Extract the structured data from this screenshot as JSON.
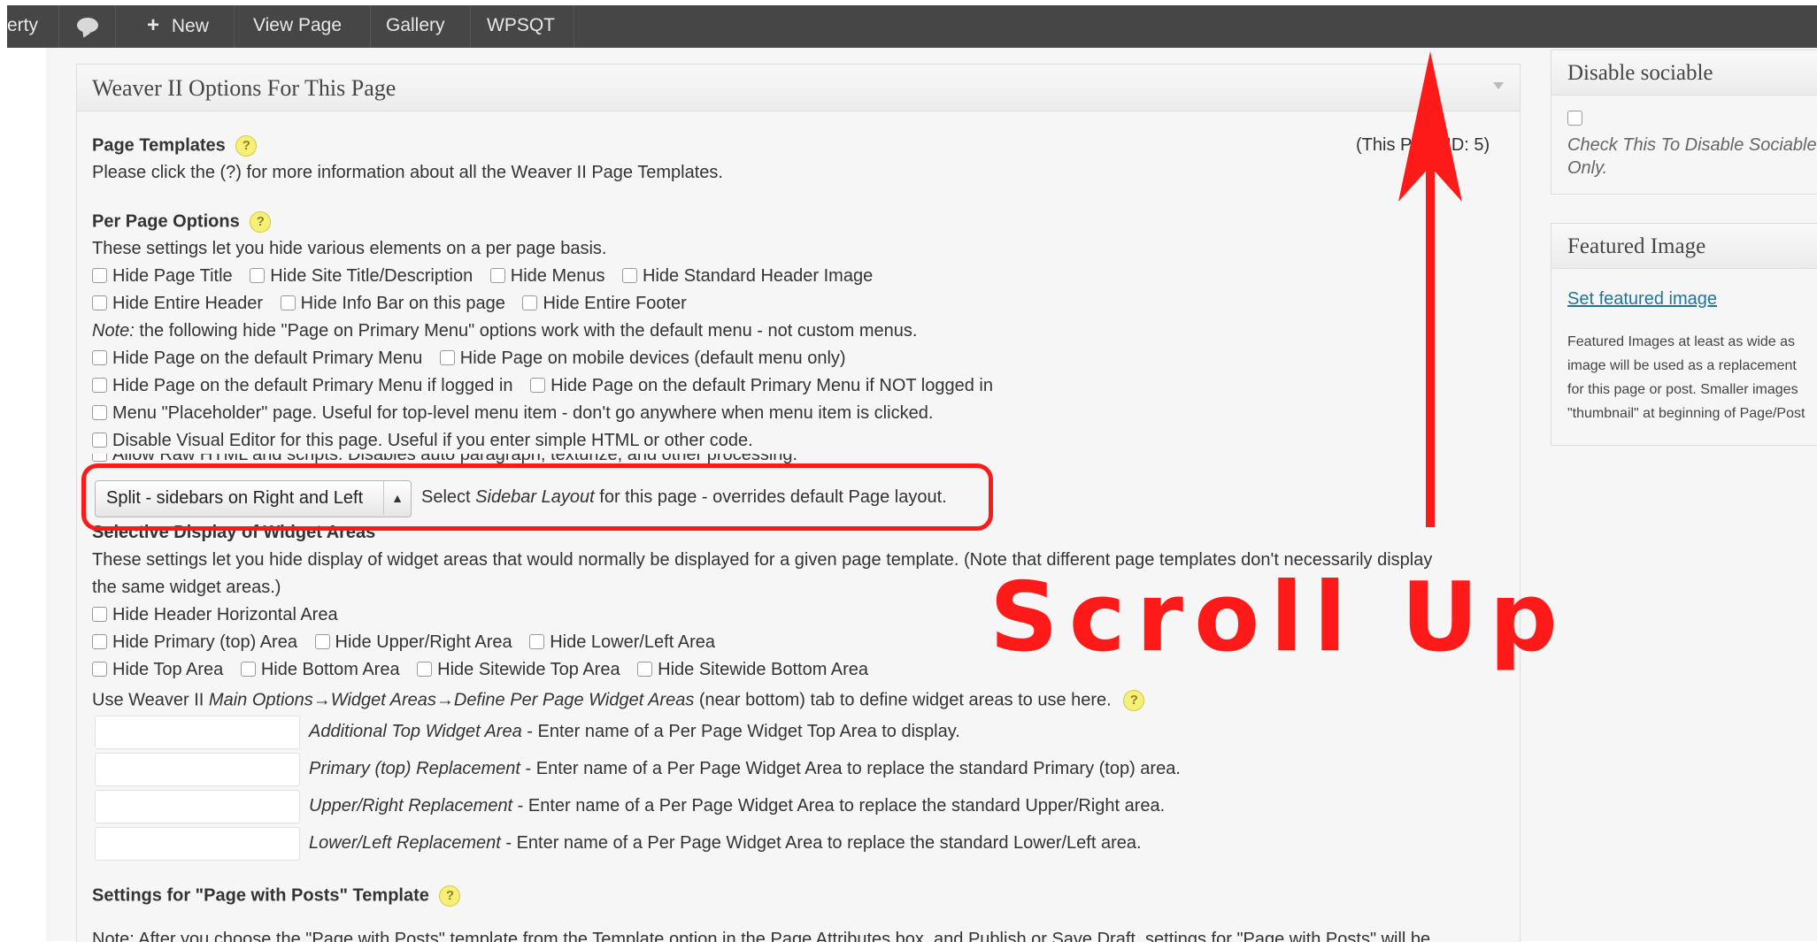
{
  "adminbar": {
    "site_fragment": "erty",
    "new_label": "New",
    "view_page_label": "View Page",
    "gallery_label": "Gallery",
    "wpsqt_label": "WPSQT"
  },
  "metabox": {
    "title": "Weaver II Options For This Page",
    "page_templates": {
      "heading": "Page Templates",
      "page_id_text": "(This Page ID: 5)",
      "description": "Please click the (?) for more information about all the Weaver II Page Templates."
    },
    "per_page": {
      "heading": "Per Page Options",
      "description": "These settings let you hide various elements on a per page basis.",
      "row1": [
        "Hide Page Title",
        "Hide Site Title/Description",
        "Hide Menus",
        "Hide Standard Header Image"
      ],
      "row2": [
        "Hide Entire Header",
        "Hide Info Bar on this page",
        "Hide Entire Footer"
      ],
      "note_label": "Note:",
      "note_text": " the following hide \"Page on Primary Menu\" options work with the default menu - not custom menus.",
      "row3": [
        "Hide Page on the default Primary Menu",
        "Hide Page on mobile devices (default menu only)"
      ],
      "row4": [
        "Hide Page on the default Primary Menu if logged in",
        "Hide Page on the default Primary Menu if NOT logged in"
      ],
      "placeholder_opt": "Menu \"Placeholder\" page. Useful for top-level menu item - don't go anywhere when menu item is clicked.",
      "visual_editor_opt": "Disable Visual Editor for this page. Useful if you enter simple HTML or other code.",
      "raw_html_opt": "Allow Raw HTML and scripts. Disables auto paragraph, texturize, and other processing.",
      "layout_select_value": "Split - sidebars on Right and Left",
      "layout_pre": "Select ",
      "layout_italic": "Sidebar Layout",
      "layout_post": " for this page - overrides default Page layout."
    },
    "widget_areas": {
      "heading": "Selective Display of Widget Areas",
      "description_1": "These settings let you hide display of widget areas that would normally be displayed for a given page template. (Note that different page templates don't necessarily display",
      "description_2": "the same widget areas.)",
      "row1": [
        "Hide Header Horizontal Area"
      ],
      "row2": [
        "Hide Primary (top) Area",
        "Hide Upper/Right Area",
        "Hide Lower/Left Area"
      ],
      "row3": [
        "Hide Top Area",
        "Hide Bottom Area",
        "Hide Sitewide Top Area",
        "Hide Sitewide Bottom Area"
      ],
      "use_pre": "Use Weaver II ",
      "use_italic": "Main Options→Widget Areas→Define Per Page Widget Areas",
      "use_post": " (near bottom) tab to define widget areas to use here.",
      "fields": [
        {
          "italic": "Additional Top Widget Area",
          "text": " - Enter name of a Per Page Widget Top Area to display."
        },
        {
          "italic": "Primary (top) Replacement",
          "text": " - Enter name of a Per Page Widget Area to replace the standard Primary (top) area."
        },
        {
          "italic": "Upper/Right Replacement",
          "text": " - Enter name of a Per Page Widget Area to replace the standard Upper/Right area."
        },
        {
          "italic": "Lower/Left Replacement",
          "text": " - Enter name of a Per Page Widget Area to replace the standard Lower/Left area."
        }
      ]
    },
    "posts_template": {
      "heading": "Settings for \"Page with Posts\" Template",
      "note_cut": "Note: After you choose the \"Page with Posts\" template from the Template option in the Page Attributes box, and Publish or Save Draft, settings for \"Page with Posts\" will be"
    }
  },
  "annotation": {
    "text": "Scroll Up",
    "color": "#ff1a1a"
  },
  "sidebar": {
    "sociable": {
      "title": "Disable sociable",
      "check_text_1": "Check This To Disable Sociable",
      "check_text_2": "Only."
    },
    "featured": {
      "title": "Featured Image",
      "link": "Set featured image",
      "lines": [
        "Featured Images at least as wide as",
        "image will be used as a replacement",
        "for this page or post. Smaller images",
        "\"thumbnail\" at beginning of Page/Post"
      ]
    }
  }
}
